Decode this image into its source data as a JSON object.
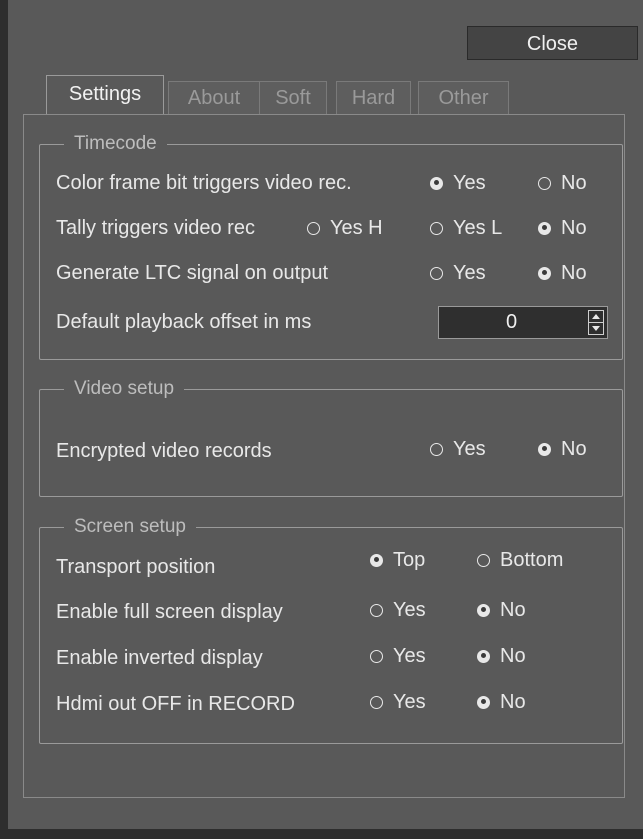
{
  "close_label": "Close",
  "tabs": [
    {
      "label": "Settings",
      "active": true
    },
    {
      "label": "About"
    },
    {
      "label": "Soft"
    },
    {
      "label": "Hard"
    },
    {
      "label": "Other"
    }
  ],
  "timecode": {
    "title": "Timecode",
    "color_frame": {
      "label": "Color frame bit triggers video rec.",
      "opt_yes": "Yes",
      "opt_no": "No",
      "selected": "Yes"
    },
    "tally": {
      "label": "Tally triggers video rec",
      "opt_yes_h": "Yes H",
      "opt_yes_l": "Yes L",
      "opt_no": "No",
      "selected": "No"
    },
    "ltc": {
      "label": "Generate LTC signal on output",
      "opt_yes": "Yes",
      "opt_no": "No",
      "selected": "No"
    },
    "playback_offset": {
      "label": "Default playback offset in ms",
      "value": "0"
    }
  },
  "video_setup": {
    "title": "Video setup",
    "encrypted": {
      "label": "Encrypted video records",
      "opt_yes": "Yes",
      "opt_no": "No",
      "selected": "No"
    }
  },
  "screen_setup": {
    "title": "Screen setup",
    "transport": {
      "label": "Transport position",
      "opt_top": "Top",
      "opt_bottom": "Bottom",
      "selected": "Top"
    },
    "fullscreen": {
      "label": "Enable full screen display",
      "opt_yes": "Yes",
      "opt_no": "No",
      "selected": "No"
    },
    "inverted": {
      "label": "Enable inverted  display",
      "opt_yes": "Yes",
      "opt_no": "No",
      "selected": "No"
    },
    "hdmi": {
      "label": "Hdmi out OFF in RECORD",
      "opt_yes": "Yes",
      "opt_no": "No",
      "selected": "No"
    }
  }
}
